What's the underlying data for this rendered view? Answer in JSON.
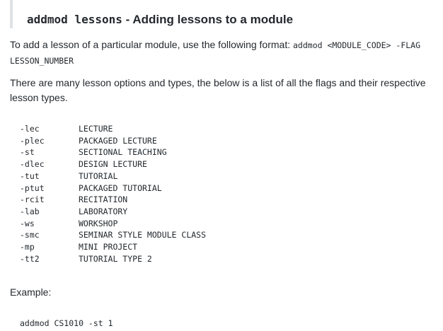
{
  "heading": {
    "command": "addmod lessons",
    "title": " - Adding lessons to a module"
  },
  "intro": {
    "text": "To add a lesson of a particular module, use the following format: ",
    "format_code": "addmod <MODULE_CODE> -FLAG LESSON_NUMBER"
  },
  "options_text": "There are many lesson options and types, the below is a list of all the flags and their respective lesson types.",
  "flags": [
    {
      "flag": "-lec",
      "type": "LECTURE"
    },
    {
      "flag": "-plec",
      "type": "PACKAGED LECTURE"
    },
    {
      "flag": "-st",
      "type": "SECTIONAL TEACHING"
    },
    {
      "flag": "-dlec",
      "type": "DESIGN LECTURE"
    },
    {
      "flag": "-tut",
      "type": "TUTORIAL"
    },
    {
      "flag": "-ptut",
      "type": "PACKAGED TUTORIAL"
    },
    {
      "flag": "-rcit",
      "type": "RECITATION"
    },
    {
      "flag": "-lab",
      "type": "LABORATORY"
    },
    {
      "flag": "-ws",
      "type": "WORKSHOP"
    },
    {
      "flag": "-smc",
      "type": "SEMINAR STYLE MODULE CLASS"
    },
    {
      "flag": "-mp",
      "type": "MINI PROJECT"
    },
    {
      "flag": "-tt2",
      "type": "TUTORIAL TYPE 2"
    }
  ],
  "example": {
    "label": "Example:",
    "code": "addmod CS1010 -st 1"
  }
}
